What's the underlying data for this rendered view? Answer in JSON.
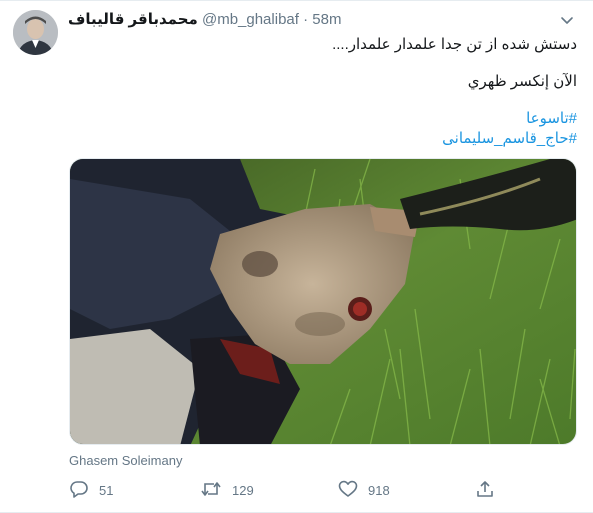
{
  "tweet": {
    "display_name": "محمدباقر قالیباف",
    "handle": "@mb_ghalibaf",
    "separator": "·",
    "time": "58m",
    "lines": [
      "دستش شده از تن جدا علمدار علمدار....",
      "الآن إنکسر ظهري"
    ],
    "hashtags": [
      "#تاسوعا",
      "#حاج_قاسم_سلیمانی"
    ],
    "photo_credit": "Ghasem Soleimany"
  },
  "actions": {
    "reply_count": "51",
    "retweet_count": "129",
    "like_count": "918"
  },
  "icons": {
    "avatar": "profile-photo",
    "menu": "chevron-down-icon",
    "reply": "reply-icon",
    "retweet": "retweet-icon",
    "like": "heart-icon",
    "share": "share-icon"
  },
  "colors": {
    "text": "#14171a",
    "secondary": "#657786",
    "link": "#1b95e0",
    "border": "#e6ecf0"
  }
}
